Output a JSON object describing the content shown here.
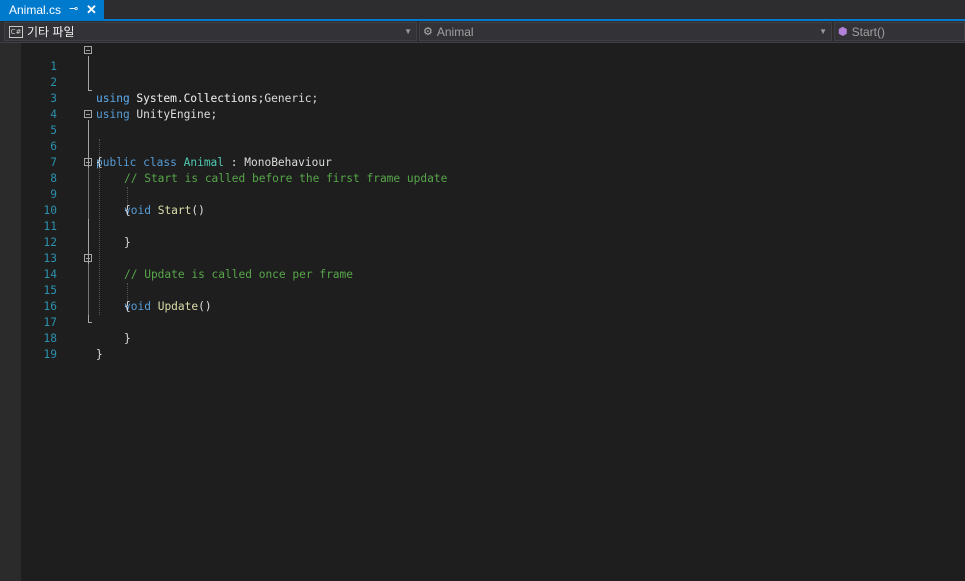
{
  "tab": {
    "title": "Animal.cs",
    "pin_glyph": "⊸",
    "close_glyph": "✕"
  },
  "nav": {
    "project": "기타 파일",
    "project_icon": "C#",
    "type": "Animal",
    "member": "Start()"
  },
  "colors": {
    "accent": "#007acc",
    "keyword": "#569cd6",
    "type": "#4ec9b0",
    "comment": "#57a64a",
    "method": "#dcdcaa",
    "line_number": "#2b91af"
  },
  "code": {
    "l1": {
      "kw": "using",
      "rest": " System.Collections;"
    },
    "l2": {
      "kw": "using",
      "rest": " System.Collections.Generic;"
    },
    "l3": {
      "kw": "using",
      "rest": " UnityEngine;"
    },
    "l5": {
      "kw1": "public",
      "kw2": "class",
      "type": "Animal",
      "sep": " : ",
      "base": "MonoBehaviour"
    },
    "l6": {
      "text": "{"
    },
    "l7": {
      "comment": "// Start is called before the first frame update"
    },
    "l8": {
      "kw": "void",
      "fn": "Start",
      "paren": "()"
    },
    "l9": {
      "text": "{"
    },
    "l11": {
      "text": "}"
    },
    "l13": {
      "comment": "// Update is called once per frame"
    },
    "l14": {
      "kw": "void",
      "fn": "Update",
      "paren": "()"
    },
    "l15": {
      "text": "{"
    },
    "l17": {
      "text": "}"
    },
    "l18": {
      "text": "}"
    }
  },
  "line_numbers": [
    "1",
    "2",
    "3",
    "4",
    "5",
    "6",
    "7",
    "8",
    "9",
    "10",
    "11",
    "12",
    "13",
    "14",
    "15",
    "16",
    "17",
    "18",
    "19"
  ]
}
